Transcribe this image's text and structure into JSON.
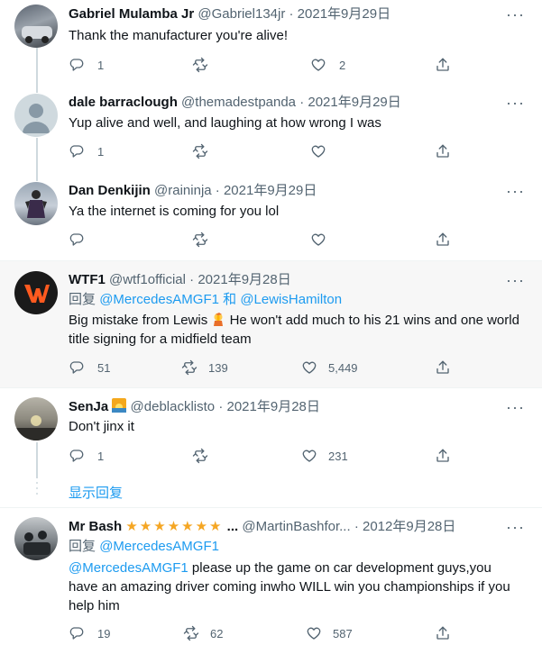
{
  "tweets": [
    {
      "name": "Gabriel Mulamba Jr",
      "handle": "@Gabriel134jr",
      "sep": "·",
      "time": "2021年9月29日",
      "text": "Thank the manufacturer you're alive!",
      "replies": "1",
      "retweets": "",
      "likes": "2"
    },
    {
      "name": "dale barraclough",
      "handle": "@themadestpanda",
      "sep": "·",
      "time": "2021年9月29日",
      "text": "Yup alive and well, and laughing at how wrong I was",
      "replies": "1",
      "retweets": "",
      "likes": ""
    },
    {
      "name": "Dan Denkijin",
      "handle": "@raininja",
      "sep": "·",
      "time": "2021年9月29日",
      "text": "Ya the internet is coming for you lol",
      "replies": "",
      "retweets": "",
      "likes": ""
    },
    {
      "name": "WTF1",
      "handle": "@wtf1official",
      "sep": "·",
      "time": "2021年9月28日",
      "reply_prefix": "回复",
      "reply_user1": "@MercedesAMGF1",
      "reply_and": "和",
      "reply_user2": "@LewisHamilton",
      "text_a": "Big mistake from Lewis",
      "text_b": " He won't add much to his 21 wins and one world title signing for a midfield team",
      "replies": "51",
      "retweets": "139",
      "likes": "5,449"
    },
    {
      "name": "SenJa",
      "handle": "@deblacklisto",
      "sep": "·",
      "time": "2021年9月28日",
      "text": "Don't jinx it",
      "replies": "1",
      "retweets": "",
      "likes": "231"
    },
    {
      "name": "Mr Bash",
      "stars": "★★★★★★★",
      "ellipsis": "...",
      "handle": "@MartinBashfor...",
      "sep": "·",
      "time": "2012年9月28日",
      "reply_prefix": "回复",
      "reply_user1": "@MercedesAMGF1",
      "mention": "@MercedesAMGF1",
      "text": " please up the game on car development guys,you have an amazing driver coming inwho WILL win you championships if you help him",
      "replies": "19",
      "retweets": "62",
      "likes": "587"
    }
  ],
  "show_replies": "显示回复",
  "colors": {
    "accent": "#1d9bf0",
    "muted": "#536471",
    "highlight_bg": "#f7f7f7",
    "wtf1_bg": "#1a1a1a",
    "wtf1_logo": "#ff5a1f"
  }
}
